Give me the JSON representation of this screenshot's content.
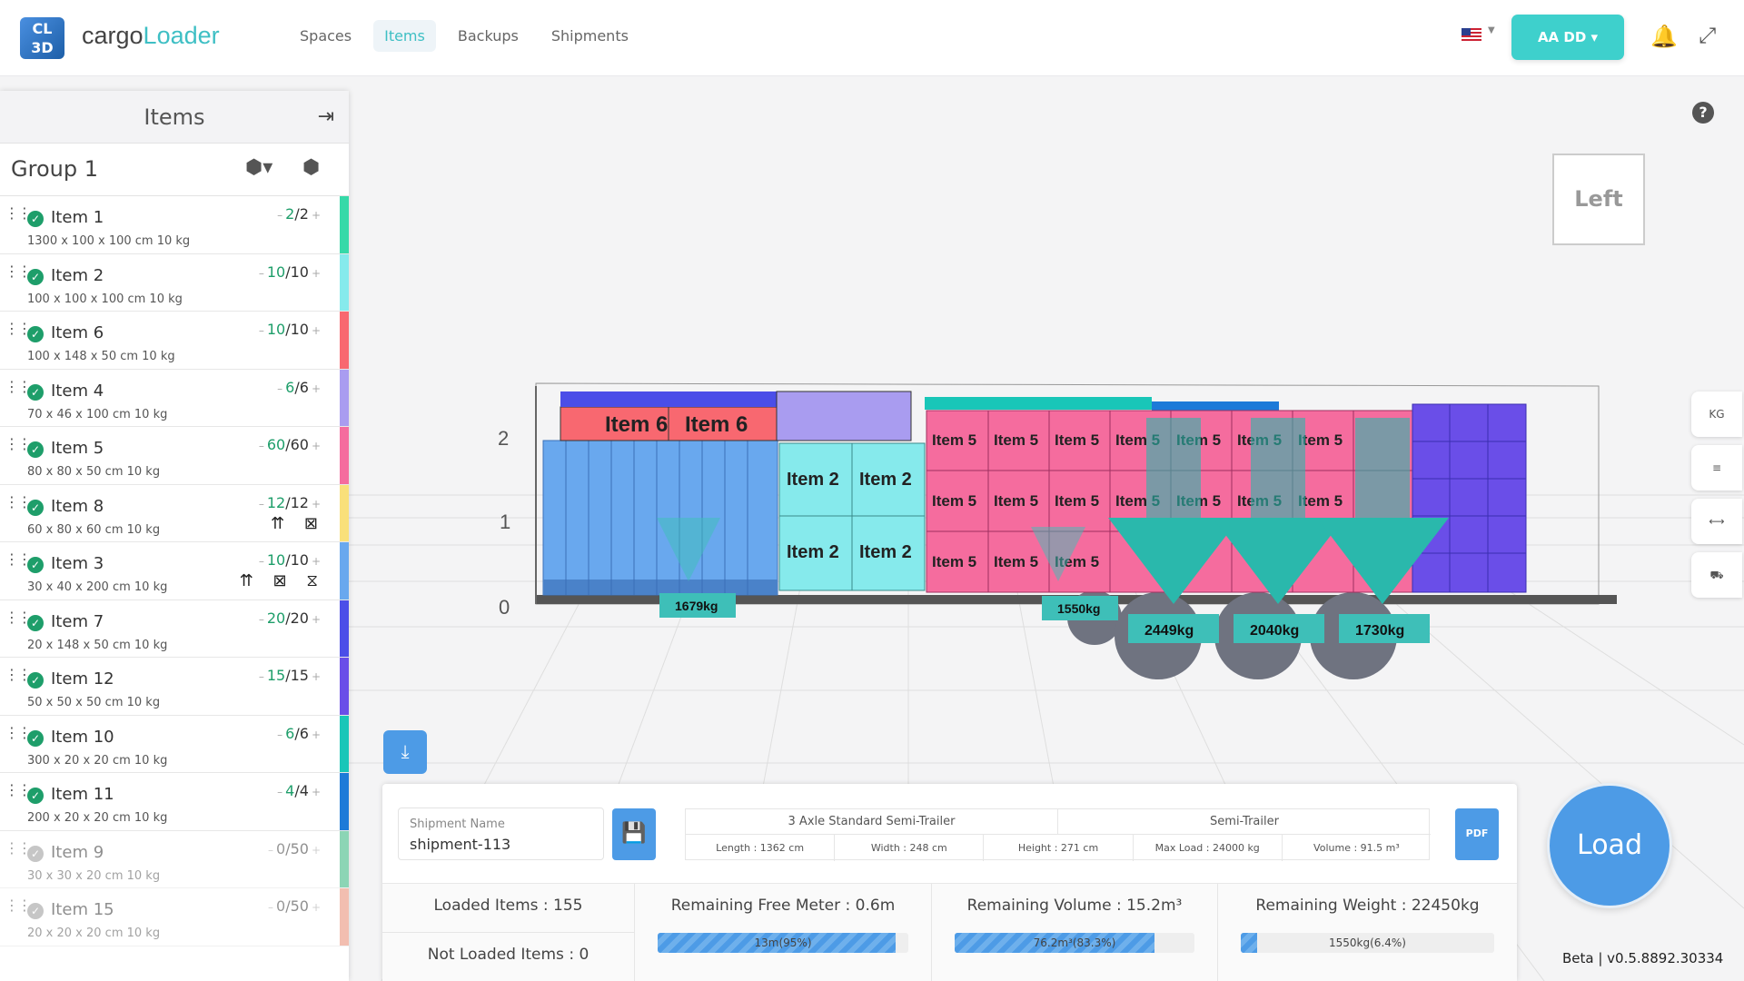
{
  "app": {
    "brand_part1": "cargo",
    "brand_part2": "Loader",
    "logo_text": "CL 3D"
  },
  "nav": [
    "Spaces",
    "Items",
    "Backups",
    "Shipments"
  ],
  "nav_active": "Items",
  "user": {
    "label": "AA DD ▾"
  },
  "sidebar": {
    "title": "Items",
    "group_title": "Group 1",
    "items": [
      {
        "name": "Item 1",
        "dims": "1300 x 100 x 100 cm 10 kg",
        "loaded": "2",
        "total": "2",
        "color": "#36d9a8",
        "dim": false,
        "badges": ""
      },
      {
        "name": "Item 2",
        "dims": "100 x 100 x 100 cm 10 kg",
        "loaded": "10",
        "total": "10",
        "color": "#86eaec",
        "dim": false,
        "badges": ""
      },
      {
        "name": "Item 6",
        "dims": "100 x 148 x 50 cm 10 kg",
        "loaded": "10",
        "total": "10",
        "color": "#f86870",
        "dim": false,
        "badges": ""
      },
      {
        "name": "Item 4",
        "dims": "70 x 46 x 100 cm 10 kg",
        "loaded": "6",
        "total": "6",
        "color": "#a99cf0",
        "dim": false,
        "badges": ""
      },
      {
        "name": "Item 5",
        "dims": "80 x 80 x 50 cm 10 kg",
        "loaded": "60",
        "total": "60",
        "color": "#f56c9e",
        "dim": false,
        "badges": ""
      },
      {
        "name": "Item 8",
        "dims": "60 x 80 x 60 cm 10 kg",
        "loaded": "12",
        "total": "12",
        "color": "#f9e07a",
        "dim": false,
        "badges": "⇈ ⊠"
      },
      {
        "name": "Item 3",
        "dims": "30 x 40 x 200 cm 10 kg",
        "loaded": "10",
        "total": "10",
        "color": "#69a8ee",
        "dim": false,
        "badges": "⇈ ⊠ ⧖"
      },
      {
        "name": "Item 7",
        "dims": "20 x 148 x 50 cm 10 kg",
        "loaded": "20",
        "total": "20",
        "color": "#4b4ee8",
        "dim": false,
        "badges": ""
      },
      {
        "name": "Item 12",
        "dims": "50 x 50 x 50 cm 10 kg",
        "loaded": "15",
        "total": "15",
        "color": "#6a4ee8",
        "dim": false,
        "badges": ""
      },
      {
        "name": "Item 10",
        "dims": "300 x 20 x 20 cm 10 kg",
        "loaded": "6",
        "total": "6",
        "color": "#19c6b8",
        "dim": false,
        "badges": ""
      },
      {
        "name": "Item 11",
        "dims": "200 x 20 x 20 cm 10 kg",
        "loaded": "4",
        "total": "4",
        "color": "#1d7ad8",
        "dim": false,
        "badges": ""
      },
      {
        "name": "Item 9",
        "dims": "30 x 30 x 20 cm 10 kg",
        "loaded": "0",
        "total": "50",
        "color": "#2fb47a",
        "dim": true,
        "badges": ""
      },
      {
        "name": "Item 15",
        "dims": "20 x 20 x 20 cm 10 kg",
        "loaded": "0",
        "total": "50",
        "color": "#e98a70",
        "dim": true,
        "badges": ""
      }
    ]
  },
  "viewer": {
    "view_cube_label": "Left",
    "axis_labels": [
      "2",
      "1",
      "0"
    ],
    "weights": [
      "1679kg",
      "1550kg",
      "2449kg",
      "2040kg",
      "1730kg"
    ],
    "tools": [
      "KG",
      "≡",
      "⟷",
      "⛟"
    ]
  },
  "panel": {
    "shipment_name_label": "Shipment Name",
    "shipment_name_value": "shipment-113",
    "trailer_type": "3 Axle Standard Semi-Trailer",
    "trailer_class": "Semi-Trailer",
    "specs": [
      "Length : 1362 cm",
      "Width : 248 cm",
      "Height : 271 cm",
      "Max Load : 24000 kg",
      "Volume : 91.5 m³"
    ],
    "pdf_label": "PDF",
    "loaded_items": "Loaded Items : 155",
    "not_loaded_items": "Not Loaded Items : 0",
    "free_meter_title": "Remaining Free Meter : 0.6m",
    "free_meter_bar": "13m(95%)",
    "free_meter_pct": 95,
    "volume_title": "Remaining Volume : 15.2m³",
    "volume_bar": "76.2m³(83.3%)",
    "volume_pct": 83.3,
    "weight_title": "Remaining Weight : 22450kg",
    "weight_bar": "1550kg(6.4%)",
    "weight_pct": 6.4
  },
  "load_button": "Load",
  "version": "Beta | v0.5.8892.30334"
}
